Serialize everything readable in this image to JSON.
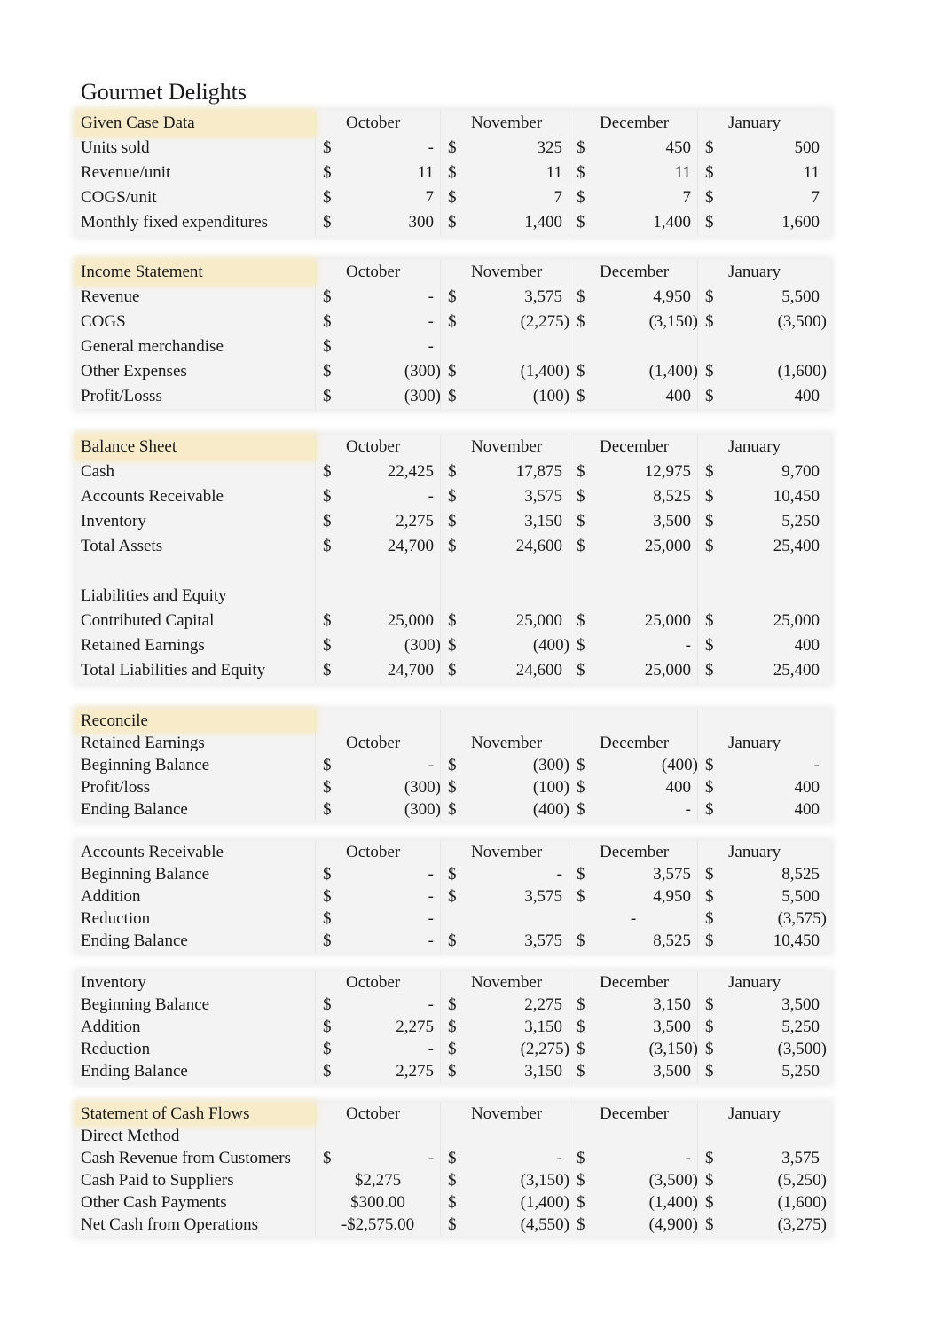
{
  "title": "Gourmet Delights",
  "sections": [
    {
      "rows": [
        {
          "label": "Given Case Data",
          "highlight": true,
          "months": [
            "October",
            "November",
            "December",
            "January"
          ]
        },
        {
          "label": "Units sold",
          "cells": [
            [
              "$",
              "-"
            ],
            [
              "$",
              "325"
            ],
            [
              "$",
              "450"
            ],
            [
              "$",
              "500"
            ]
          ]
        },
        {
          "label": "Revenue/unit",
          "cells": [
            [
              "$",
              "11"
            ],
            [
              "$",
              "11"
            ],
            [
              "$",
              "11"
            ],
            [
              "$",
              "11"
            ]
          ]
        },
        {
          "label": "COGS/unit",
          "cells": [
            [
              "$",
              "7"
            ],
            [
              "$",
              "7"
            ],
            [
              "$",
              "7"
            ],
            [
              "$",
              "7"
            ]
          ]
        },
        {
          "label": "Monthly fixed expenditures",
          "cells": [
            [
              "$",
              "300"
            ],
            [
              "$",
              "1,400"
            ],
            [
              "$",
              "1,400"
            ],
            [
              "$",
              "1,600"
            ]
          ]
        }
      ]
    },
    {
      "rows": [
        {
          "label": "Income Statement",
          "highlight": true,
          "months": [
            "October",
            "November",
            "December",
            "January"
          ]
        },
        {
          "label": "Revenue",
          "cells": [
            [
              "$",
              "-"
            ],
            [
              "$",
              "3,575"
            ],
            [
              "$",
              "4,950"
            ],
            [
              "$",
              "5,500"
            ]
          ]
        },
        {
          "label": "COGS",
          "cells": [
            [
              "$",
              "-"
            ],
            [
              "$",
              "(2,275)"
            ],
            [
              "$",
              "(3,150)"
            ],
            [
              "$",
              "(3,500)"
            ]
          ]
        },
        {
          "label": "General merchandise",
          "cells": [
            [
              "$",
              "-"
            ],
            null,
            null,
            null
          ]
        },
        {
          "label": "Other Expenses",
          "cells": [
            [
              "$",
              "(300)"
            ],
            [
              "$",
              "(1,400)"
            ],
            [
              "$",
              "(1,400)"
            ],
            [
              "$",
              "(1,600)"
            ]
          ]
        },
        {
          "label": "Profit/Losss",
          "cells": [
            [
              "$",
              "(300)"
            ],
            [
              "$",
              "(100)"
            ],
            [
              "$",
              "400"
            ],
            [
              "$",
              "400"
            ]
          ]
        }
      ]
    },
    {
      "rows": [
        {
          "label": "Balance Sheet",
          "highlight": true,
          "months": [
            "October",
            "November",
            "December",
            "January"
          ]
        },
        {
          "label": "Cash",
          "cells": [
            [
              "$",
              "22,425"
            ],
            [
              "$",
              "17,875"
            ],
            [
              "$",
              "12,975"
            ],
            [
              "$",
              "9,700"
            ]
          ]
        },
        {
          "label": "Accounts Receivable",
          "cells": [
            [
              "$",
              "-"
            ],
            [
              "$",
              "3,575"
            ],
            [
              "$",
              "8,525"
            ],
            [
              "$",
              "10,450"
            ]
          ]
        },
        {
          "label": "Inventory",
          "cells": [
            [
              "$",
              "2,275"
            ],
            [
              "$",
              "3,150"
            ],
            [
              "$",
              "3,500"
            ],
            [
              "$",
              "5,250"
            ]
          ]
        },
        {
          "label": "Total Assets",
          "cells": [
            [
              "$",
              "24,700"
            ],
            [
              "$",
              "24,600"
            ],
            [
              "$",
              "25,000"
            ],
            [
              "$",
              "25,400"
            ]
          ]
        },
        {
          "label": "",
          "cells": [
            null,
            null,
            null,
            null
          ]
        },
        {
          "label": "Liabilities and Equity",
          "cells": [
            null,
            null,
            null,
            null
          ]
        },
        {
          "label": "Contributed Capital",
          "cells": [
            [
              "$",
              "25,000"
            ],
            [
              "$",
              "25,000"
            ],
            [
              "$",
              "25,000"
            ],
            [
              "$",
              "25,000"
            ]
          ]
        },
        {
          "label": "Retained Earnings",
          "cells": [
            [
              "$",
              "(300)"
            ],
            [
              "$",
              "(400)"
            ],
            [
              "$",
              "-"
            ],
            [
              "$",
              "400"
            ]
          ]
        },
        {
          "label": "Total Liabilities and Equity",
          "cells": [
            [
              "$",
              "24,700"
            ],
            [
              "$",
              "24,600"
            ],
            [
              "$",
              "25,000"
            ],
            [
              "$",
              "25,400"
            ]
          ]
        }
      ]
    },
    {
      "rows": [
        {
          "label": "Reconcile",
          "highlight": true,
          "cells": []
        },
        {
          "label": "Retained Earnings",
          "months": [
            "October",
            "November",
            "December",
            "January"
          ]
        },
        {
          "label": "Beginning Balance",
          "cells": [
            [
              "$",
              "-"
            ],
            [
              "$",
              "(300)"
            ],
            [
              "$",
              "(400)"
            ],
            [
              "$",
              "-"
            ]
          ]
        },
        {
          "label": "Profit/loss",
          "cells": [
            [
              "$",
              "(300)"
            ],
            [
              "$",
              "(100)"
            ],
            [
              "$",
              "400"
            ],
            [
              "$",
              "400"
            ]
          ]
        },
        {
          "label": "Ending Balance",
          "cells": [
            [
              "$",
              "(300)"
            ],
            [
              "$",
              "(400)"
            ],
            [
              "$",
              "-"
            ],
            [
              "$",
              "400"
            ]
          ]
        }
      ]
    },
    {
      "rows": [
        {
          "label": "Accounts Receivable",
          "months": [
            "October",
            "November",
            "December",
            "January"
          ]
        },
        {
          "label": "Beginning Balance",
          "cells": [
            [
              "$",
              "-"
            ],
            [
              "$",
              "-"
            ],
            [
              "$",
              "3,575"
            ],
            [
              "$",
              "8,525"
            ]
          ]
        },
        {
          "label": "Addition",
          "cells": [
            [
              "$",
              "-"
            ],
            [
              "$",
              "3,575"
            ],
            [
              "$",
              "4,950"
            ],
            [
              "$",
              "5,500"
            ]
          ]
        },
        {
          "label": "Reduction",
          "cells": [
            [
              "$",
              "-"
            ],
            null,
            [
              "",
              "-",
              "center"
            ],
            [
              "$",
              "(3,575)"
            ]
          ]
        },
        {
          "label": "Ending Balance",
          "cells": [
            [
              "$",
              "-"
            ],
            [
              "$",
              "3,575"
            ],
            [
              "$",
              "8,525"
            ],
            [
              "$",
              "10,450"
            ]
          ]
        }
      ]
    },
    {
      "rows": [
        {
          "label": "Inventory",
          "months": [
            "October",
            "November",
            "December",
            "January"
          ]
        },
        {
          "label": "Beginning Balance",
          "cells": [
            [
              "$",
              "-"
            ],
            [
              "$",
              "2,275"
            ],
            [
              "$",
              "3,150"
            ],
            [
              "$",
              "3,500"
            ]
          ]
        },
        {
          "label": "Addition",
          "cells": [
            [
              "$",
              "2,275"
            ],
            [
              "$",
              "3,150"
            ],
            [
              "$",
              "3,500"
            ],
            [
              "$",
              "5,250"
            ]
          ]
        },
        {
          "label": "Reduction",
          "cells": [
            [
              "$",
              "-"
            ],
            [
              "$",
              "(2,275)"
            ],
            [
              "$",
              "(3,150)"
            ],
            [
              "$",
              "(3,500)"
            ]
          ]
        },
        {
          "label": "Ending Balance",
          "cells": [
            [
              "$",
              "2,275"
            ],
            [
              "$",
              "3,150"
            ],
            [
              "$",
              "3,500"
            ],
            [
              "$",
              "5,250"
            ]
          ]
        }
      ]
    },
    {
      "rows": [
        {
          "label": "Statement of Cash Flows",
          "highlight": true,
          "months": [
            "October",
            "November",
            "December",
            "January"
          ]
        },
        {
          "label": "Direct Method",
          "cells": [
            null,
            null,
            null,
            null
          ]
        },
        {
          "label": "Cash Revenue from Customers",
          "cells": [
            [
              "$",
              "-"
            ],
            [
              "$",
              "-"
            ],
            [
              "$",
              "-"
            ],
            [
              "$",
              "3,575"
            ]
          ]
        },
        {
          "label": "Cash Paid to Suppliers",
          "cells": [
            [
              "",
              "$2,275",
              "center"
            ],
            [
              "$",
              "(3,150)"
            ],
            [
              "$",
              "(3,500)"
            ],
            [
              "$",
              "(5,250)"
            ]
          ]
        },
        {
          "label": "Other Cash Payments",
          "cells": [
            [
              "",
              "$300.00",
              "center"
            ],
            [
              "$",
              "(1,400)"
            ],
            [
              "$",
              "(1,400)"
            ],
            [
              "$",
              "(1,600)"
            ]
          ]
        },
        {
          "label": "Net Cash from Operations",
          "cells": [
            [
              "",
              "-$2,575.00",
              "center"
            ],
            [
              "$",
              "(4,550)"
            ],
            [
              "$",
              "(4,900)"
            ],
            [
              "$",
              "(3,275)"
            ]
          ]
        }
      ]
    }
  ]
}
